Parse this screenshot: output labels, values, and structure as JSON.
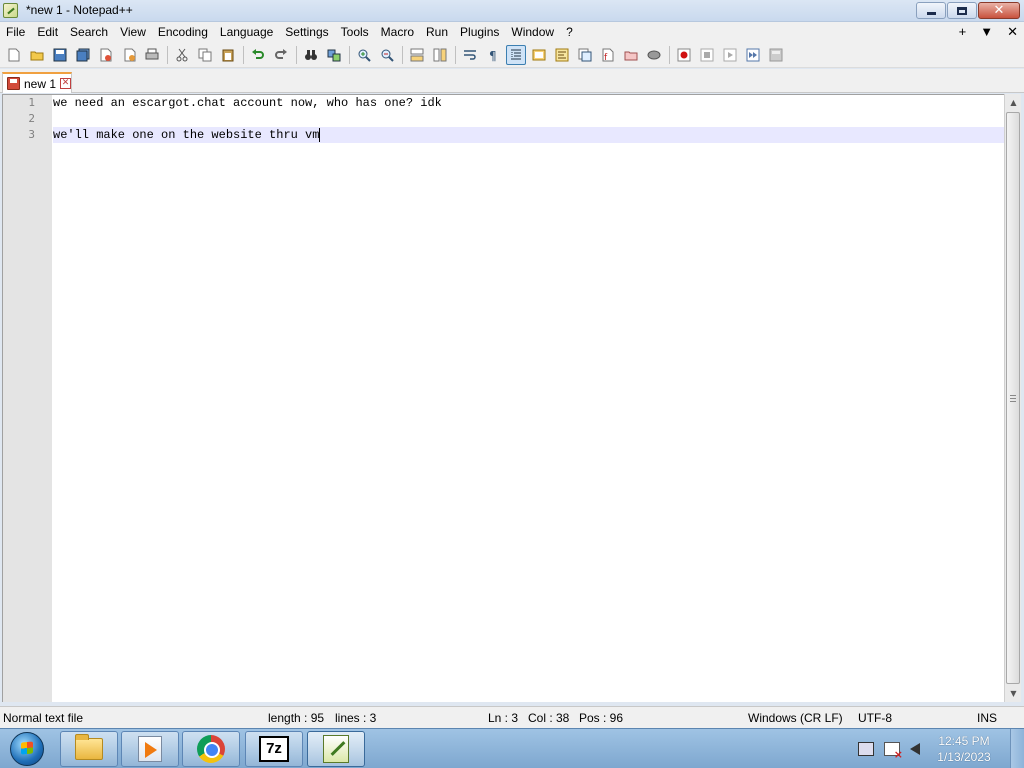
{
  "window": {
    "title": "*new 1 - Notepad++"
  },
  "menu": {
    "items": [
      "File",
      "Edit",
      "Search",
      "View",
      "Encoding",
      "Language",
      "Settings",
      "Tools",
      "Macro",
      "Run",
      "Plugins",
      "Window",
      "?"
    ],
    "right_icons": [
      "+",
      "▼",
      "✕"
    ]
  },
  "toolbar": {
    "buttons": [
      "new-file",
      "open-file",
      "save",
      "save-all",
      "close",
      "close-all",
      "print",
      "cut",
      "copy",
      "paste",
      "undo",
      "redo",
      "find",
      "replace",
      "zoom-in",
      "zoom-out",
      "sync-vertical",
      "sync-horizontal",
      "word-wrap",
      "all-characters",
      "indent-guide",
      "define-language",
      "document-map",
      "function-list",
      "folder-as-workspace",
      "monitoring",
      "record-macro",
      "stop-recording",
      "playback-macro",
      "run-macro-multiple",
      "save-macro"
    ]
  },
  "tabs": [
    {
      "label": "new 1",
      "modified": true
    }
  ],
  "editor": {
    "lines": [
      {
        "number": "1",
        "text": "we need an escargot.chat account now, who has one? idk"
      },
      {
        "number": "2",
        "text": ""
      },
      {
        "number": "3",
        "text": "we'll make one on the website thru vm"
      }
    ],
    "current_line_color": "#e8e8ff"
  },
  "status": {
    "file_type": "Normal text file",
    "length": "length : 95",
    "lines": "lines : 3",
    "ln": "Ln : 3",
    "col": "Col : 38",
    "pos": "Pos : 96",
    "eol": "Windows (CR LF)",
    "encoding": "UTF-8",
    "mode": "INS"
  },
  "taskbar": {
    "apps": [
      "file-explorer",
      "media-player",
      "chrome",
      "7-zip",
      "notepad-plus-plus"
    ],
    "active_app": "notepad-plus-plus",
    "clock_time": "12:45 PM",
    "clock_date": "1/13/2023"
  }
}
